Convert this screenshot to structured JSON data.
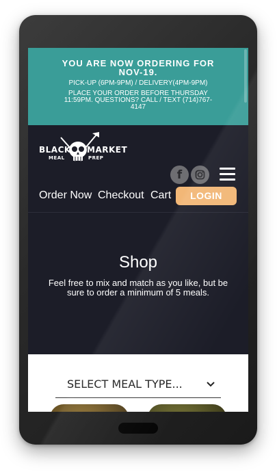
{
  "banner": {
    "ordering_for": "YOU ARE NOW ORDERING FOR NOV-19.",
    "hours": "PICK-UP (6PM-9PM) / DELIVERY(4PM-9PM)",
    "deadline": "PLACE YOUR ORDER BEFORE THURSDAY 11:59PM. QUESTIONS? CALL / TEXT (714)767-4147"
  },
  "logo": {
    "word_black": "BLACK",
    "word_market": "MARKET",
    "word_meal": "MEAL",
    "word_prep": "PREP"
  },
  "social": {
    "facebook_glyph": "f"
  },
  "nav": {
    "order_now": "Order Now",
    "checkout": "Checkout",
    "cart": "Cart",
    "login": "LOGIN"
  },
  "hero": {
    "title": "Shop",
    "subtitle": "Feel free to mix and match as you like, but be sure to order a minimum of 5 meals."
  },
  "filter": {
    "select_label": "SELECT MEAL TYPE..."
  },
  "colors": {
    "banner_bg": "#3a9d98",
    "header_bg": "#1c1d28",
    "login_bg": "#f2b777"
  }
}
